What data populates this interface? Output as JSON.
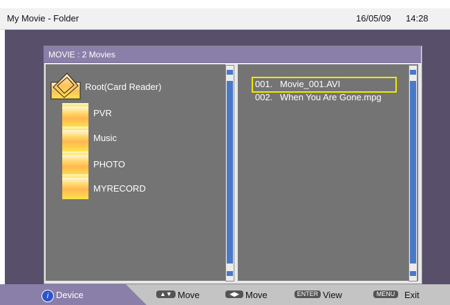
{
  "header": {
    "title": "My Movie - Folder",
    "date": "16/05/09",
    "time": "14:28"
  },
  "panel": {
    "title": "MOVIE : 2 Movies"
  },
  "tree": {
    "root_label": "Root(Card Reader)",
    "folders": [
      {
        "label": "PVR"
      },
      {
        "label": "Music"
      },
      {
        "label": "PHOTO"
      },
      {
        "label": "MYRECORD"
      }
    ]
  },
  "files": [
    {
      "number": "001.",
      "name": "Movie_001.AVI",
      "selected": true
    },
    {
      "number": "002.",
      "name": "When You Are Gone.mpg",
      "selected": false
    }
  ],
  "footer": {
    "device_icon": "info-icon",
    "device_label": "Device",
    "updown_key": "▲▼",
    "updown_label": "Move",
    "leftright_key": "◀▶",
    "leftright_label": "Move",
    "enter_key": "ENTER",
    "enter_label": "View",
    "menu_key": "MENU",
    "menu_label": "Exit"
  },
  "colors": {
    "background": "#58506b",
    "header_bar": "#8a7fa9",
    "pane": "#747474",
    "selection": "#f2ea00",
    "scrollbar": "#4a78c8"
  }
}
